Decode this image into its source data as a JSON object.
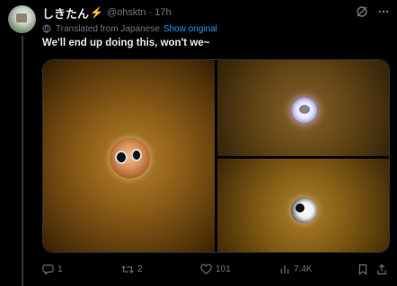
{
  "tweet": {
    "display_name": "しきたん",
    "name_emoji": "⚡",
    "handle": "@ohsktn",
    "separator": "·",
    "time": "17h",
    "translated_label": "Translated from Japanese",
    "show_original_label": "Show original",
    "text": "We'll end up doing this, won't we~"
  },
  "actions": {
    "replies": "1",
    "reposts": "2",
    "likes": "101",
    "views": "7.4K"
  },
  "colors": {
    "background": "#000000",
    "text": "#e7e9ea",
    "muted": "#71767b",
    "link": "#1d9bf0"
  },
  "icons": [
    "grok-icon",
    "more-icon",
    "translate-icon",
    "reply-icon",
    "repost-icon",
    "like-icon",
    "views-icon",
    "bookmark-icon",
    "share-icon"
  ]
}
